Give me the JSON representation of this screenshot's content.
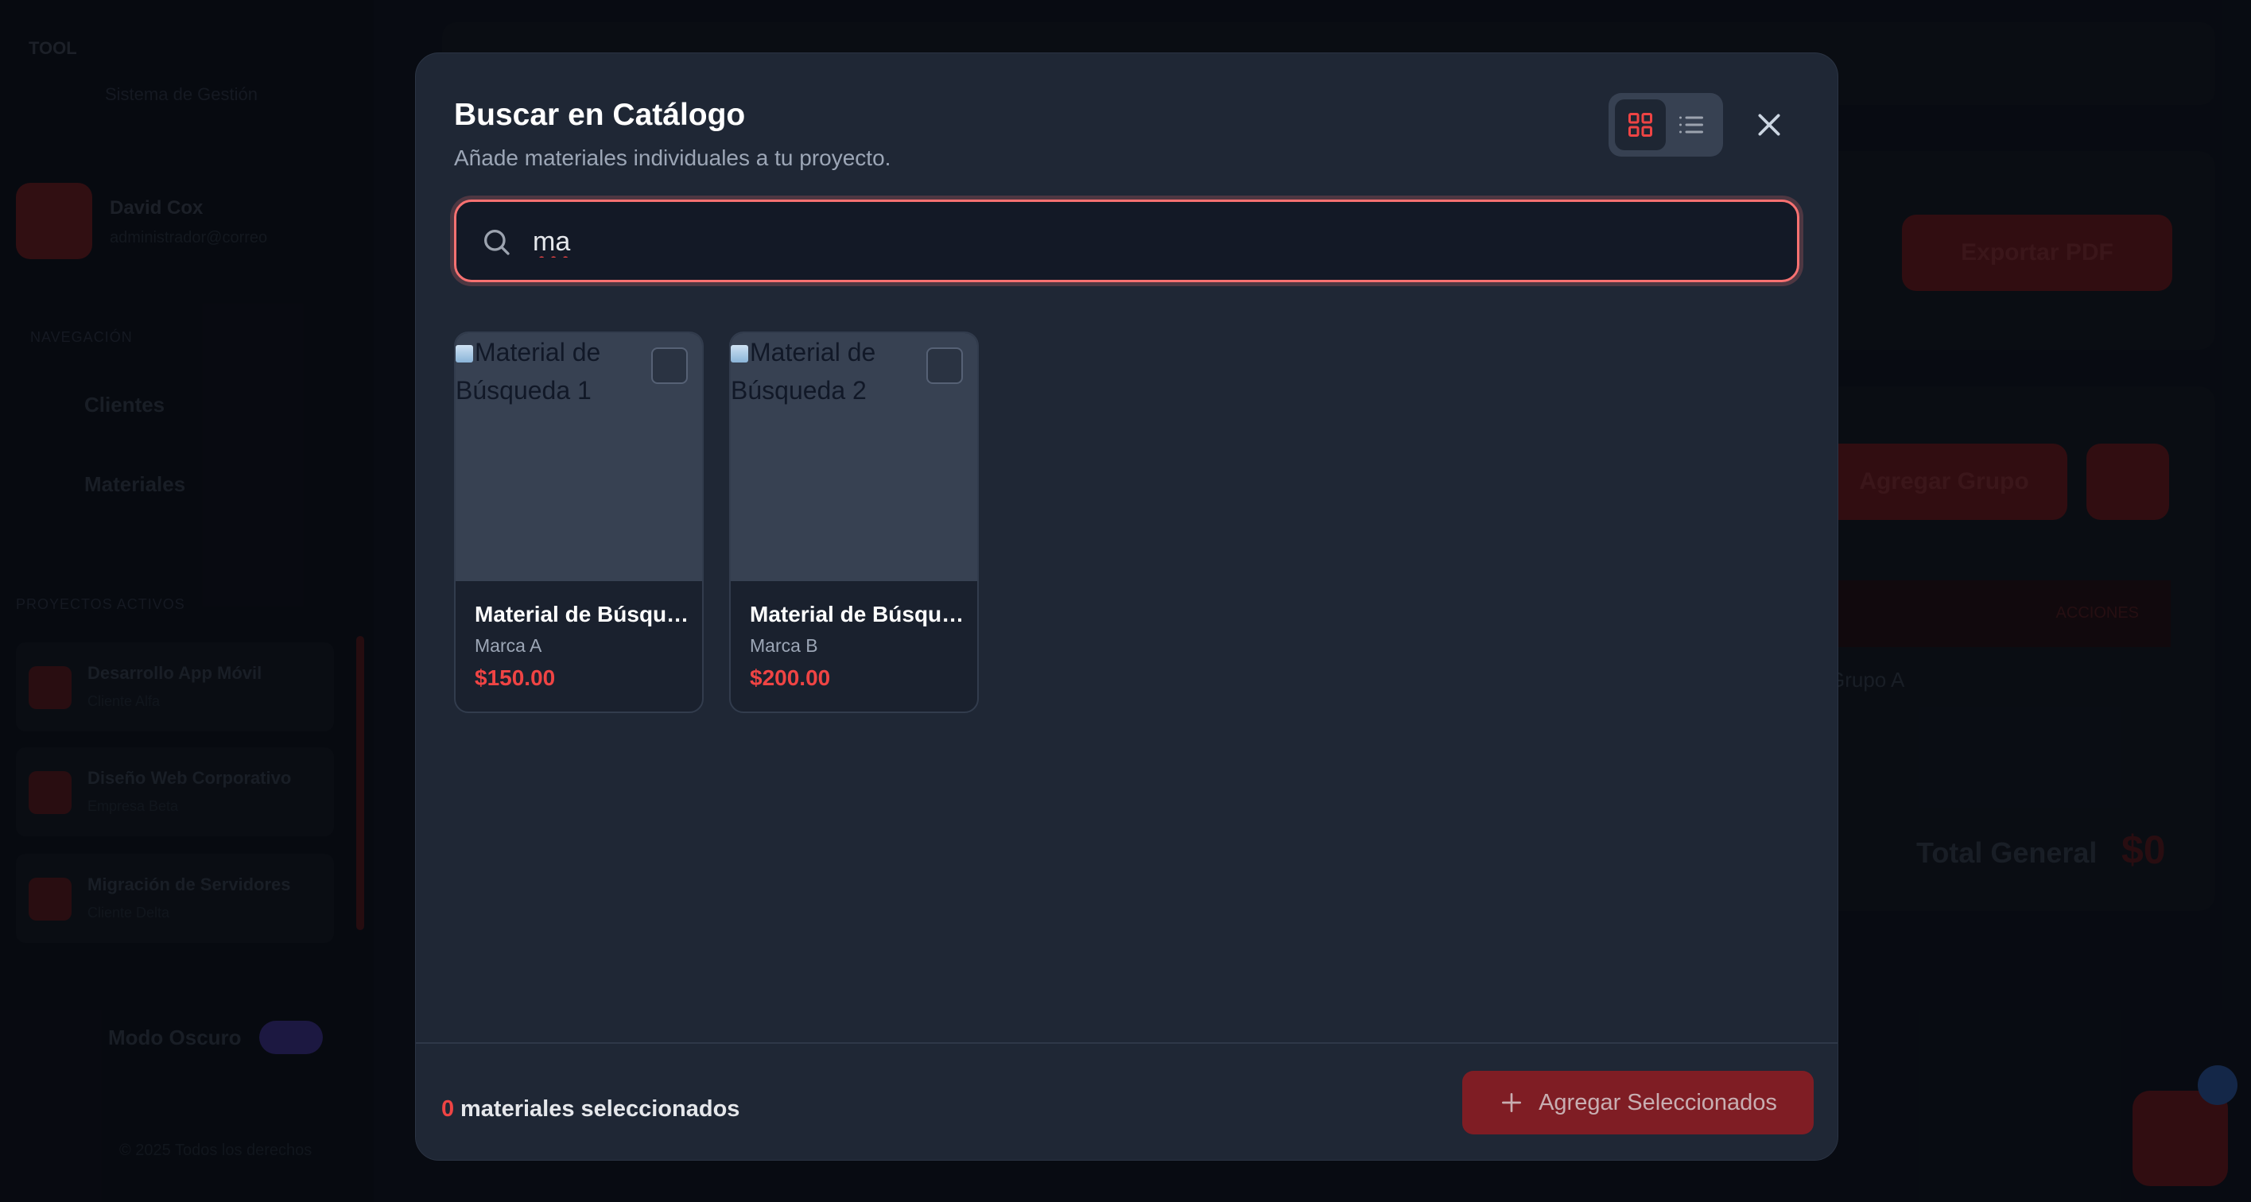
{
  "background": {
    "logo": "TOOL",
    "logo_sub": "Sistema de Gestión",
    "user_name": "David Cox",
    "user_email": "administrador@correo",
    "nav_section": "NAVEGACIÓN",
    "nav": [
      "Clientes",
      "Materiales"
    ],
    "projects_section": "PROYECTOS ACTIVOS",
    "projects": [
      {
        "title": "Desarrollo App Móvil",
        "sub": "Cliente Alfa"
      },
      {
        "title": "Diseño Web Corporativo",
        "sub": "Empresa Beta"
      },
      {
        "title": "Migración de Servidores",
        "sub": "Cliente Delta"
      }
    ],
    "dark_mode_label": "Modo Oscuro",
    "copyright": "© 2025 Todos los derechos",
    "export_pdf": "Exportar PDF",
    "add_group": "Agregar Grupo",
    "actions_header": "ACCIONES",
    "row_text": "Grupo A",
    "total_label": "Total General",
    "total_value": "$0"
  },
  "modal": {
    "title": "Buscar en Catálogo",
    "subtitle": "Añade materiales individuales a tu proyecto.",
    "view_grid_icon": "grid-icon",
    "view_list_icon": "list-icon",
    "close_icon": "close-icon",
    "search": {
      "value": "ma",
      "icon": "search-icon"
    },
    "results": [
      {
        "image_alt": "Material de Búsqueda 1",
        "name": "Material de Búsqueda 1",
        "brand": "Marca A",
        "price": "$150.00",
        "checked": false
      },
      {
        "image_alt": "Material de Búsqueda 2",
        "name": "Material de Búsqueda 2",
        "brand": "Marca B",
        "price": "$200.00",
        "checked": false
      }
    ],
    "footer": {
      "selected_count": "0",
      "selected_label": "materiales seleccionados",
      "add_button_label": "Agregar Seleccionados"
    }
  },
  "colors": {
    "accent": "#ef4444",
    "modal_bg": "#1f2735",
    "button_bg": "#7f1d24"
  }
}
